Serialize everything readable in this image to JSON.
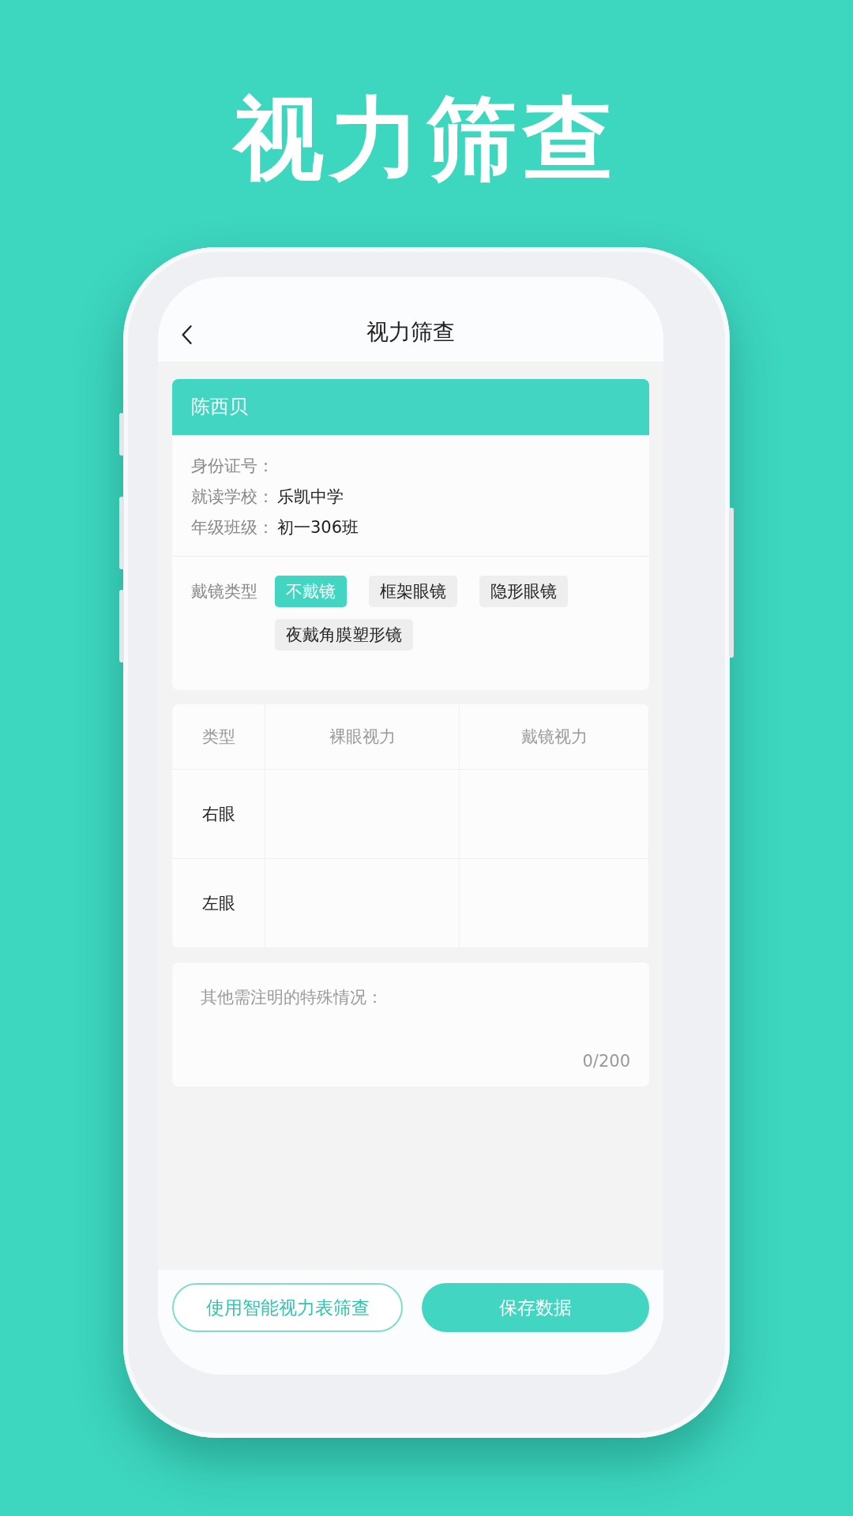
{
  "headline": "视力筛查",
  "nav": {
    "title": "视力筛查"
  },
  "student": {
    "name": "陈西贝",
    "fields": [
      {
        "label": "身份证号："
      },
      {
        "label": "就读学校：",
        "value": "乐凯中学"
      },
      {
        "label": "年级班级：",
        "value": "初一306班"
      }
    ]
  },
  "glasses": {
    "label": "戴镜类型",
    "options": [
      {
        "label": "不戴镜",
        "selected": true
      },
      {
        "label": "框架眼镜",
        "selected": false
      },
      {
        "label": "隐形眼镜",
        "selected": false
      },
      {
        "label": "夜戴角膜塑形镜",
        "selected": false
      }
    ]
  },
  "table": {
    "columns": [
      "类型",
      "裸眼视力",
      "戴镜视力"
    ],
    "rows": [
      {
        "label": "右眼"
      },
      {
        "label": "左眼"
      }
    ]
  },
  "notes": {
    "placeholder": "其他需注明的特殊情况：",
    "counter": "0/200"
  },
  "buttons": [
    {
      "label": "使用智能视力表筛查",
      "kind": "outline"
    },
    {
      "label": "保存数据",
      "kind": "primary"
    }
  ]
}
